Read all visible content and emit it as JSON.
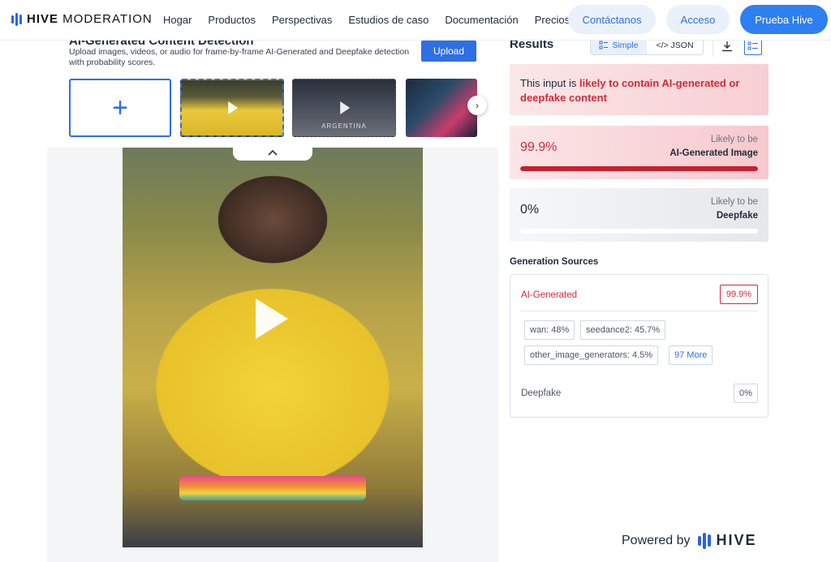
{
  "brand": {
    "name_bold": "HIVE",
    "name_rest": " MODERATION"
  },
  "nav": {
    "links": [
      "Hogar",
      "Productos",
      "Perspectivas",
      "Estudios de caso",
      "Documentación",
      "Precios"
    ],
    "contact": "Contáctanos",
    "login": "Acceso",
    "try": "Prueba Hive"
  },
  "detector": {
    "title": "AI-Generated Content Detection",
    "description": "Upload images, videos, or audio for frame-by-frame AI-Generated and Deepfake detection with probability scores.",
    "upload": "Upload",
    "add_symbol": "+",
    "thumb2_caption": "ARGENTINA"
  },
  "results": {
    "title": "Results",
    "view_simple": "Simple",
    "view_json": "</> JSON",
    "alert_prefix": "This input is ",
    "alert_emphasis": "likely to contain AI-generated or deepfake content",
    "ai_score": {
      "pct": "99.9%",
      "sub1": "Likely to be",
      "sub2": "AI-Generated Image",
      "fill": 1.0
    },
    "deepfake_score": {
      "pct": "0%",
      "sub1": "Likely to be",
      "sub2": "Deepfake",
      "fill": 0.0
    },
    "gen_title": "Generation Sources",
    "ai_label": "AI-Generated",
    "ai_value": "99.9%",
    "sources": [
      "wan: 48%",
      "seedance2: 45.7%",
      "other_image_generators: 4.5%"
    ],
    "more": "97 More",
    "deepfake_label": "Deepfake",
    "deepfake_value": "0%"
  },
  "footer": {
    "powered": "Powered by",
    "brand": "HIVE"
  },
  "colors": {
    "accent": "#2f6fe4",
    "danger": "#d42a3a"
  }
}
